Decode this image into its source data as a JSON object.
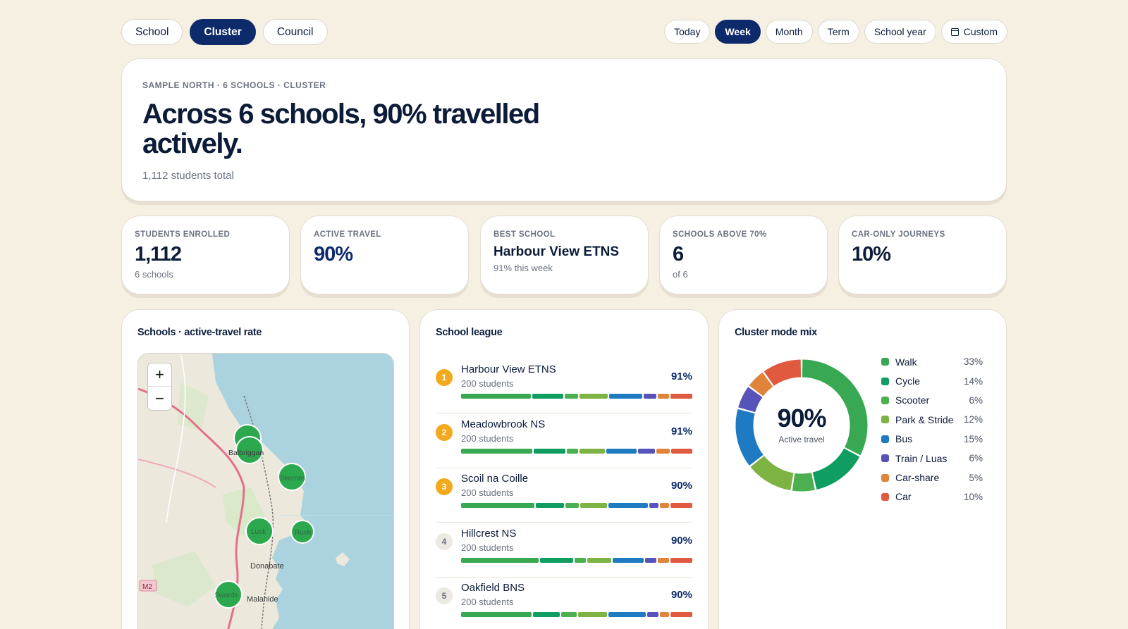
{
  "scope": {
    "options": [
      {
        "label": "School",
        "active": false
      },
      {
        "label": "Cluster",
        "active": true
      },
      {
        "label": "Council",
        "active": false
      }
    ]
  },
  "range": {
    "options": [
      {
        "label": "Today",
        "active": false
      },
      {
        "label": "Week",
        "active": true
      },
      {
        "label": "Month",
        "active": false
      },
      {
        "label": "Term",
        "active": false
      },
      {
        "label": "School year",
        "active": false
      },
      {
        "label": "Custom",
        "active": false,
        "icon": "calendar-icon"
      }
    ]
  },
  "hero": {
    "eyebrow": "SAMPLE NORTH · 6 SCHOOLS · CLUSTER",
    "title": "Across 6 schools, 90% travelled actively.",
    "subtitle": "1,112 students total"
  },
  "kpis": [
    {
      "label": "STUDENTS ENROLLED",
      "value": "1,112",
      "sub": "6 schools"
    },
    {
      "label": "ACTIVE TRAVEL",
      "value": "90%",
      "sub": ""
    },
    {
      "label": "BEST SCHOOL",
      "value": "Harbour View ETNS",
      "sub": "91% this week"
    },
    {
      "label": "SCHOOLS ABOVE 70%",
      "value": "6",
      "sub": "of 6"
    },
    {
      "label": "CAR-ONLY JOURNEYS",
      "value": "10%",
      "sub": ""
    }
  ],
  "map_panel": {
    "title": "Schools · active-travel rate",
    "zoom_in": "+",
    "zoom_out": "−",
    "place_labels": [
      "Balbriggan",
      "Skerries",
      "Lusk",
      "Rush",
      "Swords",
      "Donabate",
      "Malahide",
      "M2"
    ]
  },
  "league": {
    "title": "School league",
    "schools": [
      {
        "rank": "1",
        "name": "Harbour View ETNS",
        "students": "200 students",
        "pct": "91%",
        "mix": [
          32,
          14,
          6,
          13,
          15,
          6,
          5,
          10
        ]
      },
      {
        "rank": "2",
        "name": "Meadowbrook NS",
        "students": "200 students",
        "pct": "91%",
        "mix": [
          33,
          15,
          5,
          12,
          14,
          8,
          6,
          10
        ]
      },
      {
        "rank": "3",
        "name": "Scoil na Coille",
        "students": "200 students",
        "pct": "90%",
        "mix": [
          33,
          13,
          6,
          12,
          18,
          4,
          4,
          10
        ]
      },
      {
        "rank": "4",
        "name": "Hillcrest NS",
        "students": "200 students",
        "pct": "90%",
        "mix": [
          35,
          15,
          5,
          11,
          14,
          5,
          5,
          10
        ]
      },
      {
        "rank": "5",
        "name": "Oakfield BNS",
        "students": "200 students",
        "pct": "90%",
        "mix": [
          32,
          12,
          7,
          13,
          17,
          5,
          4,
          10
        ]
      }
    ]
  },
  "mode_mix": {
    "title": "Cluster mode mix",
    "center_value": "90%",
    "center_label": "Active travel",
    "modes": [
      {
        "name": "Walk",
        "pct": "33%",
        "value": 33,
        "color": "#38a853"
      },
      {
        "name": "Cycle",
        "pct": "14%",
        "value": 14,
        "color": "#0f9d62"
      },
      {
        "name": "Scooter",
        "pct": "6%",
        "value": 6,
        "color": "#4caf50"
      },
      {
        "name": "Park & Stride",
        "pct": "12%",
        "value": 12,
        "color": "#7cb342"
      },
      {
        "name": "Bus",
        "pct": "15%",
        "value": 15,
        "color": "#1f7bc1"
      },
      {
        "name": "Train / Luas",
        "pct": "6%",
        "value": 6,
        "color": "#5753b8"
      },
      {
        "name": "Car-share",
        "pct": "5%",
        "value": 5,
        "color": "#e0833b"
      },
      {
        "name": "Car",
        "pct": "10%",
        "value": 10,
        "color": "#e05a3f"
      }
    ]
  }
}
